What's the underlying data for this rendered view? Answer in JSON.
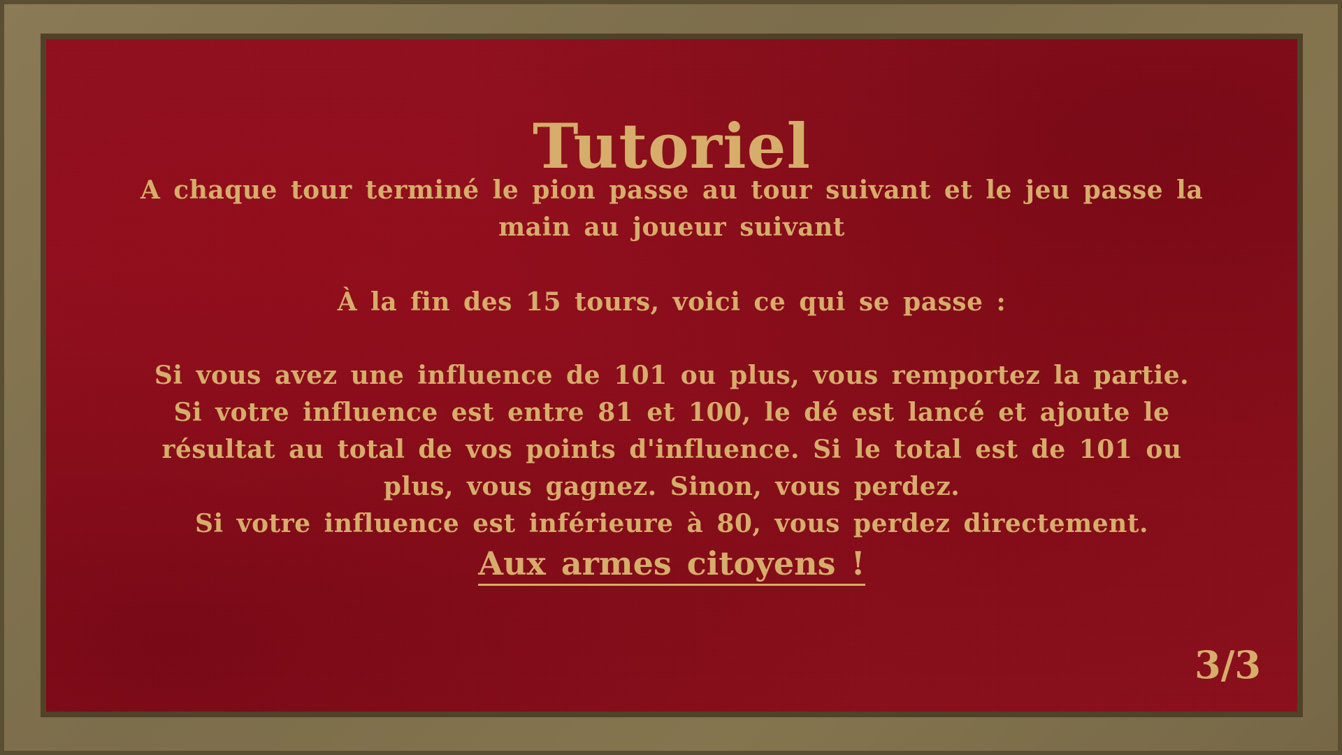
{
  "tutorial": {
    "title": "Tutoriel",
    "paragraph1": "A chaque tour terminé le pion passe au tour suivant et le jeu passe la main au joueur suivant",
    "paragraph2": "À la fin des 15 tours, voici ce qui se passe :",
    "rule_win": "Si vous avez une influence de 101 ou plus, vous remportez la partie.",
    "rule_dice": "Si votre influence est entre 81 et 100, le dé est lancé et ajoute le résultat au total de vos points d'influence. Si le total est de 101 ou plus, vous gagnez. Sinon, vous perdez.",
    "rule_lose": "Si votre influence est inférieure à 80, vous perdez directement.",
    "cta_label": "Aux armes citoyens !",
    "page_indicator": "3/3"
  },
  "colors": {
    "panel_red": "#8f0f1e",
    "gold_text": "#d6ad6a",
    "frame": "#7a6c4c"
  }
}
